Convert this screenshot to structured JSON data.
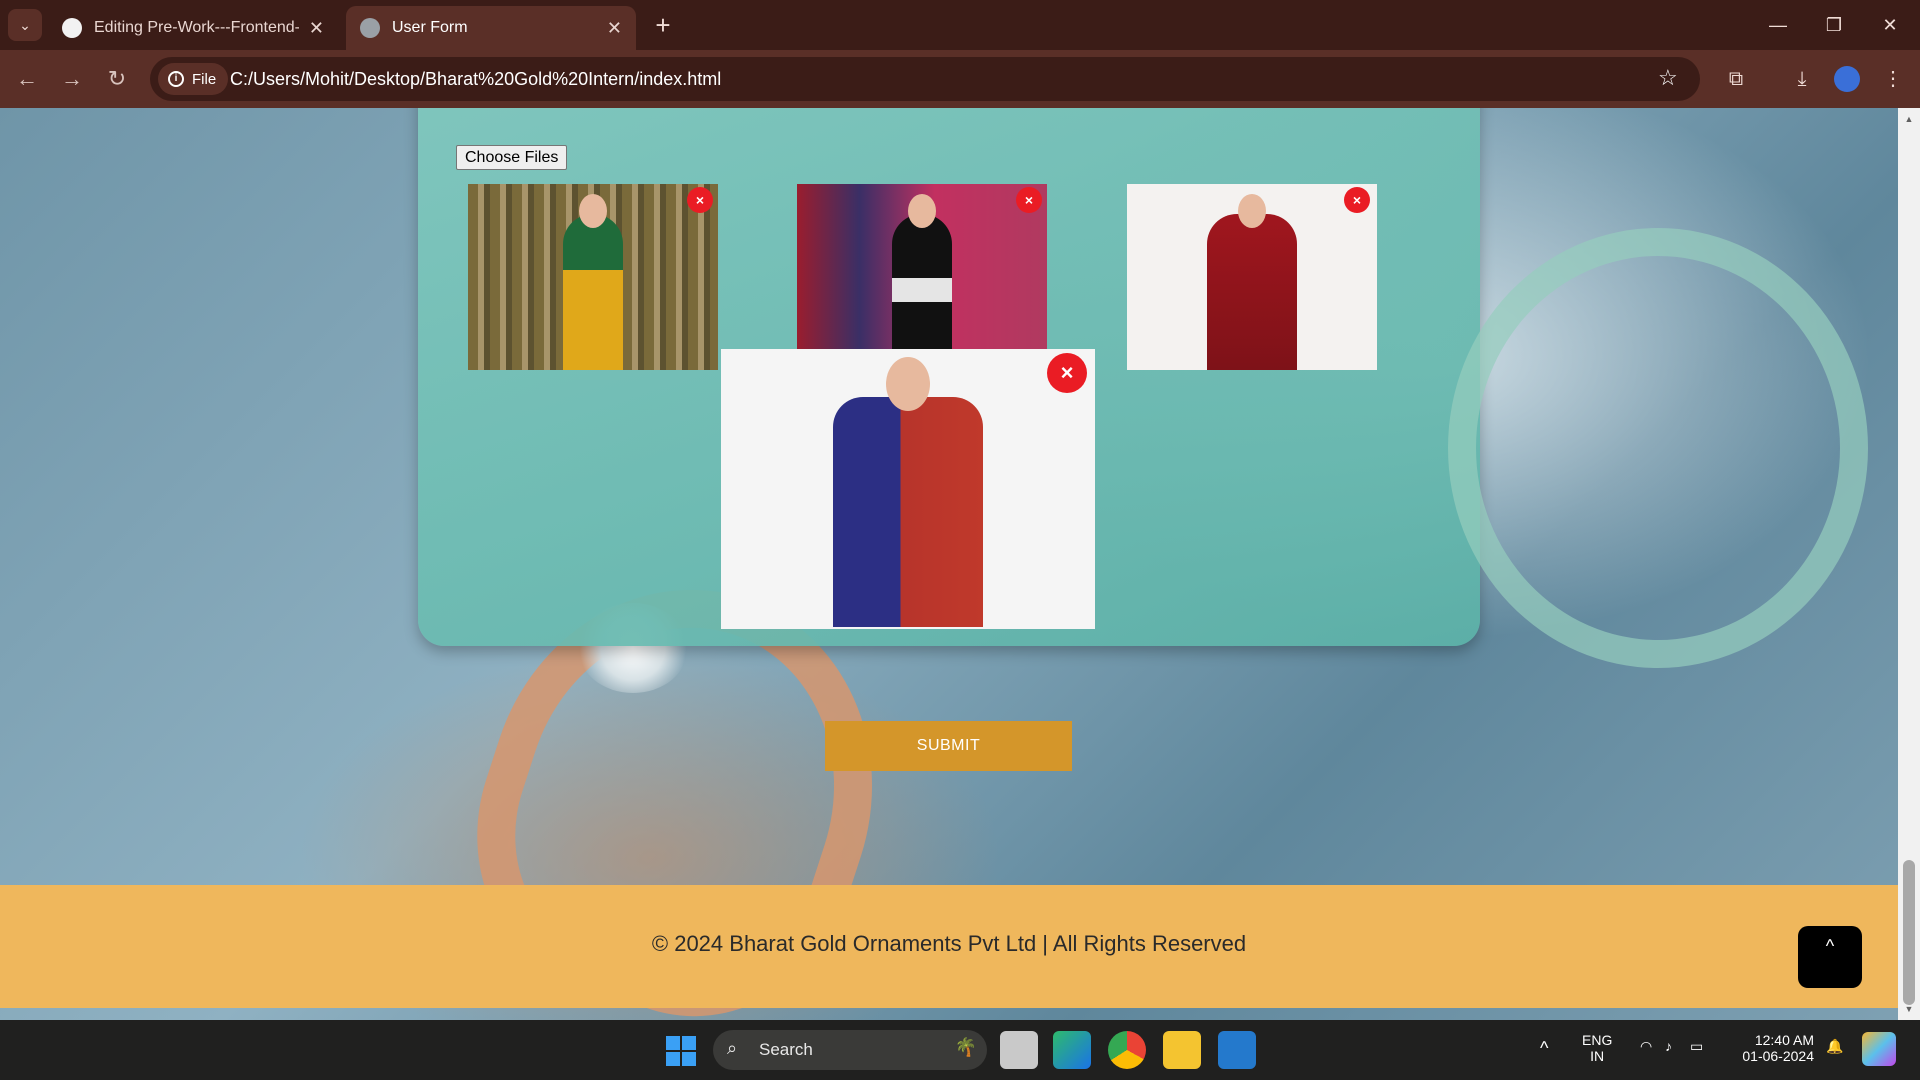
{
  "browser": {
    "tabs": [
      {
        "title": "Editing Pre-Work---Frontend-D",
        "icon": "github-icon",
        "active": false
      },
      {
        "title": "User Form",
        "icon": "globe-icon",
        "active": true
      }
    ],
    "new_tab": "+",
    "address_chip": "File",
    "url": "C:/Users/Mohit/Desktop/Bharat%20Gold%20Intern/index.html"
  },
  "page": {
    "file_button_label": "Choose Files",
    "remove_symbol": "×",
    "images": [
      {
        "alt": "Yellow and green saree on bamboo background"
      },
      {
        "alt": "Black saree with white embroidery"
      },
      {
        "alt": "Red saree"
      },
      {
        "alt": "Blue saree with red pallu (enlarged)"
      }
    ],
    "submit_label": "SUBMIT",
    "footer_text": "© 2024 Bharat Gold Ornaments Pvt Ltd | All Rights Reserved",
    "scroll_top_label": "^"
  },
  "taskbar": {
    "search_placeholder": "Search",
    "language_top": "ENG",
    "language_bottom": "IN",
    "time": "12:40 AM",
    "date": "01-06-2024"
  },
  "colors": {
    "submit": "#d4962a",
    "footer": "#efb75c",
    "remove": "#ea1c24",
    "card": "#80c8be"
  }
}
